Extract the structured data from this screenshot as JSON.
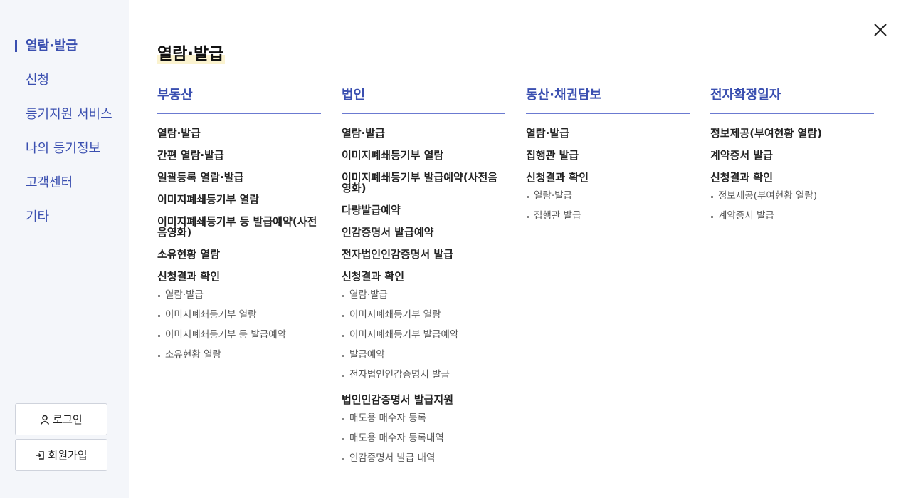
{
  "sidebar": {
    "items": [
      {
        "label": "열람·발급",
        "active": true
      },
      {
        "label": "신청"
      },
      {
        "label": "등기지원 서비스"
      },
      {
        "label": "나의 등기정보"
      },
      {
        "label": "고객센터"
      },
      {
        "label": "기타"
      }
    ],
    "login_label": "로그인",
    "join_label": "회원가입"
  },
  "main": {
    "title": "열람·발급",
    "columns": [
      {
        "heading": "부동산",
        "items": [
          "열람·발급",
          "간편 열람·발급",
          "일괄등록 열람·발급",
          "이미지폐쇄등기부 열람",
          "이미지폐쇄등기부 등 발급예약(사전음영화)",
          "소유현황 열람",
          "신청결과 확인"
        ],
        "subs": [
          "열람·발급",
          "이미지폐쇄등기부 열람",
          "이미지폐쇄등기부 등 발급예약",
          "소유현황 열람"
        ]
      },
      {
        "heading": "법인",
        "items": [
          "열람·발급",
          "이미지폐쇄등기부 열람",
          "이미지폐쇄등기부 발급예약(사전음영화)",
          "다량발급예약",
          "인감증명서 발급예약",
          "전자법인인감증명서 발급",
          "신청결과 확인"
        ],
        "subs": [
          "열람·발급",
          "이미지폐쇄등기부 열람",
          "이미지폐쇄등기부 발급예약",
          "발급예약",
          "전자법인인감증명서 발급"
        ],
        "items2": [
          "법인인감증명서 발급지원"
        ],
        "subs2": [
          "매도용 매수자 등록",
          "매도용 매수자 등록내역",
          "인감증명서 발급 내역"
        ]
      },
      {
        "heading": "동산·채권담보",
        "items": [
          "열람·발급",
          "집행관 발급",
          "신청결과 확인"
        ],
        "subs": [
          "열람·발급",
          "집행관 발급"
        ]
      },
      {
        "heading": "전자확정일자",
        "items": [
          "정보제공(부여현황 열람)",
          "계약증서 발급",
          "신청결과 확인"
        ],
        "subs": [
          "정보제공(부여현황 열람)",
          "계약증서 발급"
        ]
      }
    ]
  },
  "colors": {
    "accent": "#3a4fb0",
    "sidebar_bg": "#f4f6fa",
    "title_highlight": "#fbf3cf"
  }
}
